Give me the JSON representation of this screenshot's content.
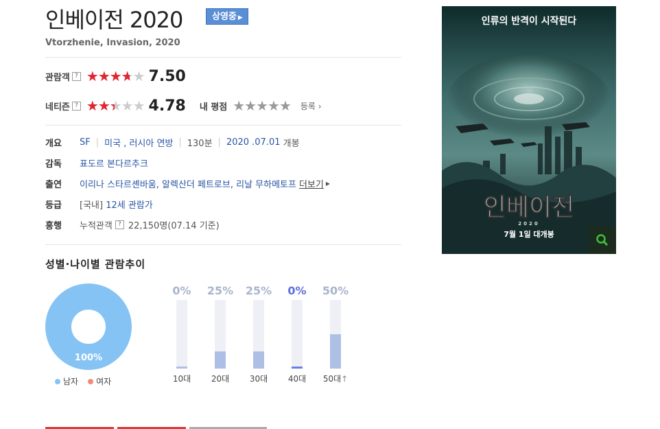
{
  "movie": {
    "title": "인베이전 2020",
    "status_badge": "상영중",
    "original_title": "Vtorzhenie, Invasion, 2020"
  },
  "ratings": {
    "audience": {
      "label": "관람객",
      "score": "7.50",
      "stars": 3.75
    },
    "netizen": {
      "label": "네티즌",
      "score": "4.78",
      "stars": 2.4
    },
    "my_rating_label": "내 평점",
    "register_label": "등록"
  },
  "info": {
    "overview": {
      "label": "개요",
      "genre": "SF",
      "country": "미국 , 러시아 연방",
      "runtime": "130분",
      "release": "2020 .07.01",
      "release_suffix": "개봉"
    },
    "director": {
      "label": "감독",
      "value": "표도르 본다르추크"
    },
    "cast": {
      "label": "출연",
      "value": "이리나 스타르셴바움, 알렉산더 페트로브, 리날 무하메토프",
      "more": "더보기"
    },
    "grade": {
      "label": "등급",
      "prefix": "[국내]",
      "value": "12세 관람가"
    },
    "box_office": {
      "label": "흥행",
      "prefix": "누적관객",
      "value": "22,150명(07.14 기준)"
    }
  },
  "trend": {
    "title": "성별·나이별 관람추이",
    "gender": {
      "male_pct": 100,
      "male_label_text": "100%",
      "male_legend": "남자",
      "female_legend": "여자"
    },
    "ages": [
      {
        "label": "10대",
        "pct": 0,
        "pct_text": "0%",
        "highlight": false
      },
      {
        "label": "20대",
        "pct": 25,
        "pct_text": "25%",
        "highlight": false
      },
      {
        "label": "30대",
        "pct": 25,
        "pct_text": "25%",
        "highlight": false
      },
      {
        "label": "40대",
        "pct": 0,
        "pct_text": "0%",
        "highlight": true
      },
      {
        "label": "50대",
        "pct": 50,
        "pct_text": "50%",
        "highlight": false
      }
    ]
  },
  "poster": {
    "tagline": "인류의 반격이 시작된다",
    "title": "인베이전",
    "year": "2020",
    "release": "7월 1일 대개봉"
  },
  "colors": {
    "male": "#86c3f5",
    "female": "#f08a7d",
    "star": "#e3232e"
  }
}
